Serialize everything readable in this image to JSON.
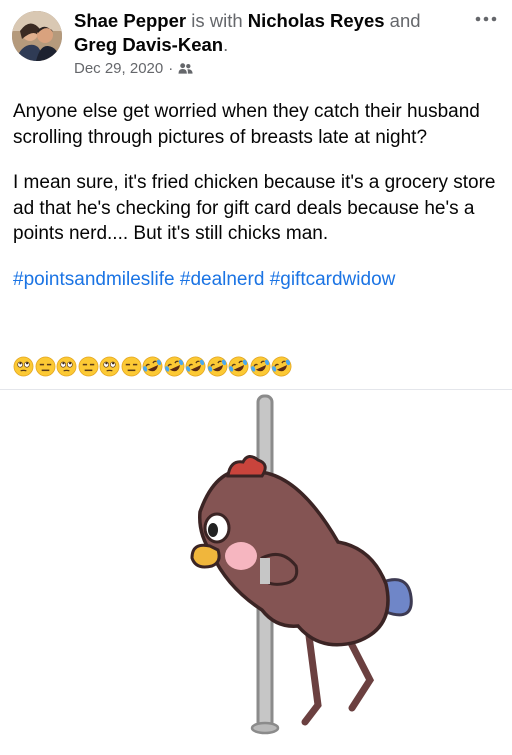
{
  "post": {
    "author": "Shae Pepper",
    "with_text": "is with",
    "tagged": [
      "Nicholas Reyes",
      "Greg Davis-Kean"
    ],
    "and_text": "and",
    "period": ".",
    "date": "Dec 29, 2020",
    "separator": "·",
    "audience_icon": "friends-icon",
    "more_icon": "more-horizontal-icon",
    "paragraphs": [
      "Anyone else get worried when they catch their husband scrolling through pictures of breasts late at night?",
      "I mean sure, it's fried chicken because it's a grocery store ad that he's checking for gift card deals because he's a points nerd.... But it's still chicks man."
    ],
    "hashtags": [
      "#pointsandmileslife",
      "#dealnerd",
      "#giftcardwidow"
    ],
    "emojis": [
      "face-with-rolling-eyes",
      "expressionless-face",
      "face-with-rolling-eyes",
      "expressionless-face",
      "face-with-rolling-eyes",
      "expressionless-face",
      "rolling-on-the-floor-laughing",
      "rolling-on-the-floor-laughing",
      "rolling-on-the-floor-laughing",
      "rolling-on-the-floor-laughing",
      "rolling-on-the-floor-laughing",
      "rolling-on-the-floor-laughing",
      "rolling-on-the-floor-laughing"
    ],
    "media": {
      "type": "animated-gif",
      "subject": "cartoon-chicken-on-pole"
    }
  },
  "colors": {
    "name": "#050505",
    "secondary": "#65676b",
    "hashtag": "#1b74e4",
    "chicken_body": "#845453",
    "comb": "#c9443c",
    "beak": "#f0b63c",
    "cheek": "#f6b6c0",
    "feet": "#6f86c8",
    "pole": "#c6c6c6"
  }
}
